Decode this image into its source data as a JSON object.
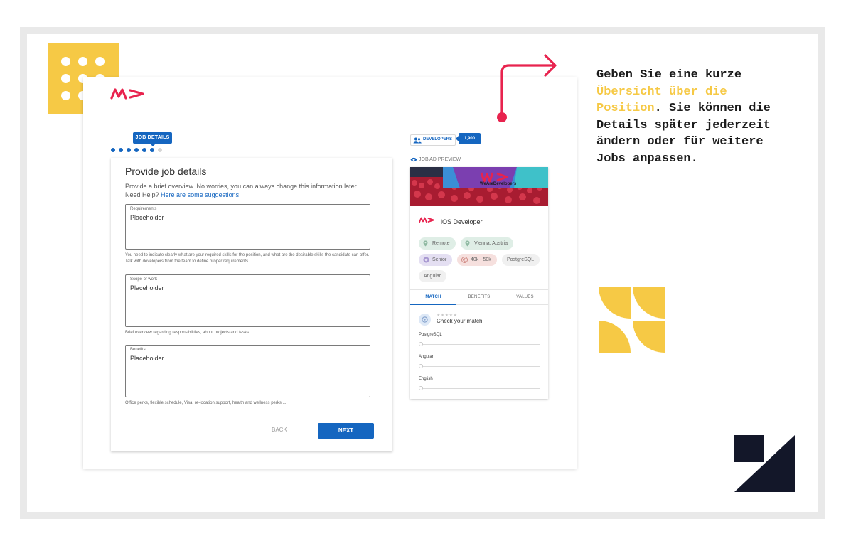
{
  "colors": {
    "brand_red": "#e8234e",
    "primary_blue": "#1566c0",
    "accent_yellow": "#f6c945",
    "dark": "#131729"
  },
  "app": {
    "logo_icon": "wearedevelopers-logo-icon"
  },
  "stepper": {
    "current_step_label": "JOB DETAILS",
    "total_steps": 7,
    "current_step": 6
  },
  "form": {
    "title": "Provide job details",
    "description": "Provide a brief overview. No worries, you can always change this information later.",
    "help_prefix": "Need Help?",
    "help_link": "Here are some suggestions",
    "fields": [
      {
        "label": "Requirements",
        "placeholder": "Placeholder",
        "helper": "You need to indicate clearly what are your required skills for the position, and what are the desirable skills the candidate can offer. Talk with developers from the team to define proper requirements."
      },
      {
        "label": "Scope of work",
        "placeholder": "Placeholder",
        "helper": "Brief overview regarding responsibilities, about projects and tasks"
      },
      {
        "label": "Benefits",
        "placeholder": "Placeholder",
        "helper": "Office perks, flexible schedule, Visa, re-location support, health and wellness perks,..."
      }
    ],
    "back_label": "BACK",
    "next_label": "NEXT"
  },
  "preview": {
    "developers_label": "DEVELOPERS",
    "developers_count": "1,900",
    "preview_label": "JOB AD PREVIEW",
    "banner_text": "WeAreDevelopers",
    "job_title": "iOS Developer",
    "tags": [
      {
        "label": "Remote",
        "icon": "location-pin-icon"
      },
      {
        "label": "Vienna, Austria",
        "icon": "location-pin-icon"
      },
      {
        "label": "Senior",
        "icon": "level-badge-icon"
      },
      {
        "label": "40k - 50k",
        "icon": "euro-icon"
      },
      {
        "label": "PostgreSQL",
        "icon": ""
      },
      {
        "label": "Angular",
        "icon": ""
      }
    ],
    "tabs": [
      "MATCH",
      "BENEFITS",
      "VALUES"
    ],
    "active_tab": "MATCH",
    "match_title": "Check your match",
    "stars": "★★★★★",
    "skills": [
      "PostgreSQL",
      "Angular",
      "English"
    ]
  },
  "marketing": {
    "line1": "Geben Sie eine kurze",
    "highlight": "Übersicht über die Position",
    "line2": ". Sie können die Details später jederzeit ändern oder für weitere Jobs anpassen."
  }
}
